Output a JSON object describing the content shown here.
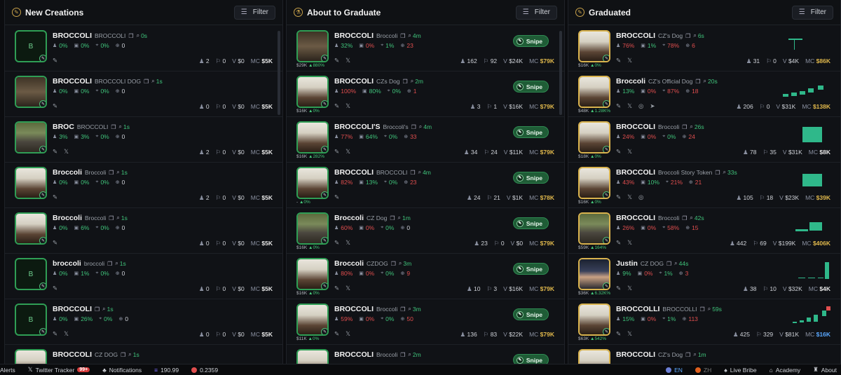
{
  "columns": [
    {
      "title": "New Creations",
      "filter": "Filter",
      "cards": [
        {
          "name": "BROCCOLI",
          "sub": "BROCCOLI",
          "age": "0s",
          "thumb": "empty",
          "letter": "B",
          "h": "0%",
          "b": "0%",
          "s": "0%",
          "t": "0",
          "holders": "2",
          "dl": "0",
          "v": "$0",
          "mc": "$5K",
          "socials": [
            "link"
          ]
        },
        {
          "name": "BROCCOLI",
          "sub": "BROCCOLI DOG",
          "age": "1s",
          "thumb": "d",
          "h": "0%",
          "b": "0%",
          "s": "0%",
          "t": "0",
          "holders": "0",
          "dl": "0",
          "v": "$0",
          "mc": "$5K",
          "socials": [
            "link"
          ]
        },
        {
          "name": "BROC",
          "sub": "BROCCOLI",
          "age": "1s",
          "thumb": "b",
          "h": "3%",
          "b": "3%",
          "s": "0%",
          "t": "0",
          "holders": "2",
          "dl": "0",
          "v": "$0",
          "mc": "$5K",
          "socials": [
            "link",
            "x"
          ]
        },
        {
          "name": "Broccoli",
          "sub": "Broccoli",
          "age": "1s",
          "thumb": "c",
          "h": "0%",
          "b": "0%",
          "s": "0%",
          "t": "0",
          "holders": "2",
          "dl": "0",
          "v": "$0",
          "mc": "$5K",
          "socials": [
            "link"
          ]
        },
        {
          "name": "Broccoli",
          "sub": "Broccoli",
          "age": "1s",
          "thumb": "c",
          "h": "0%",
          "b": "6%",
          "s": "0%",
          "t": "0",
          "holders": "0",
          "dl": "0",
          "v": "$0",
          "mc": "$5K",
          "socials": [
            "link"
          ]
        },
        {
          "name": "broccoli",
          "sub": "broccoli",
          "age": "1s",
          "thumb": "empty",
          "letter": "B",
          "h": "0%",
          "b": "1%",
          "s": "0%",
          "t": "0",
          "holders": "0",
          "dl": "0",
          "v": "$0",
          "mc": "$5K",
          "socials": [
            "link"
          ]
        },
        {
          "name": "BROCCOLI",
          "sub": "",
          "age": "1s",
          "thumb": "empty",
          "letter": "B",
          "h": "0%",
          "b": "26%",
          "s": "0%",
          "t": "0",
          "holders": "0",
          "dl": "0",
          "v": "$0",
          "mc": "$5K",
          "socials": [
            "link",
            "x"
          ]
        },
        {
          "name": "BROCCOLI",
          "sub": "CZ DOG",
          "age": "1s",
          "thumb": "c",
          "h": "",
          "b": "",
          "s": "",
          "t": "",
          "holders": "",
          "dl": "",
          "v": "",
          "mc": "",
          "socials": []
        }
      ]
    },
    {
      "title": "About to Graduate",
      "filter": "Filter",
      "cards": [
        {
          "name": "BROCCOLI",
          "sub": "Broccoli",
          "age": "4m",
          "thumb": "d",
          "cap": "$29K",
          "chg": "880%",
          "h": "32%",
          "b": "0%",
          "s": "1%",
          "t": "23",
          "holders": "162",
          "dl": "92",
          "v": "$24K",
          "mc": "$79K",
          "socials": [
            "link",
            "x"
          ]
        },
        {
          "name": "BROCCOLI",
          "sub": "CZs Dog",
          "age": "2m",
          "thumb": "c",
          "cap": "$16K",
          "chg": "0%",
          "h": "100%",
          "b": "80%",
          "s": "0%",
          "t": "1",
          "holders": "3",
          "dl": "1",
          "v": "$16K",
          "mc": "$79K",
          "socials": [
            "link",
            "x"
          ]
        },
        {
          "name": "BROCCOLI'S",
          "sub": "Broccoli's",
          "age": "4m",
          "thumb": "c",
          "cap": "$16K",
          "chg": "282%",
          "h": "77%",
          "b": "64%",
          "s": "0%",
          "t": "33",
          "holders": "34",
          "dl": "24",
          "v": "$11K",
          "mc": "$79K",
          "socials": [
            "link",
            "x"
          ]
        },
        {
          "name": "BROCCOLI",
          "sub": "BROCCOLI",
          "age": "4m",
          "thumb": "c",
          "cap": "-",
          "chg": "0%",
          "h": "82%",
          "b": "13%",
          "s": "0%",
          "t": "23",
          "holders": "24",
          "dl": "21",
          "v": "$1K",
          "mc": "$78K",
          "socials": [
            "link"
          ]
        },
        {
          "name": "Broccoli",
          "sub": "CZ Dog",
          "age": "1m",
          "thumb": "b",
          "cap": "$16K",
          "chg": "0%",
          "h": "60%",
          "b": "0%",
          "s": "0%",
          "t": "0",
          "holders": "23",
          "dl": "0",
          "v": "$0",
          "mc": "$79K",
          "socials": [
            "link",
            "x"
          ]
        },
        {
          "name": "Broccoli",
          "sub": "CZDOG",
          "age": "3m",
          "thumb": "c",
          "cap": "$16K",
          "chg": "0%",
          "h": "80%",
          "b": "0%",
          "s": "0%",
          "t": "9",
          "holders": "10",
          "dl": "3",
          "v": "$16K",
          "mc": "$79K",
          "socials": [
            "link",
            "x"
          ]
        },
        {
          "name": "BROCCOLI",
          "sub": "Broccoli",
          "age": "3m",
          "thumb": "c",
          "cap": "$11K",
          "chg": "0%",
          "h": "59%",
          "b": "0%",
          "s": "0%",
          "t": "50",
          "holders": "136",
          "dl": "83",
          "v": "$22K",
          "mc": "$79K",
          "socials": [
            "link",
            "x"
          ]
        },
        {
          "name": "BROCCOLI",
          "sub": "Broccoli",
          "age": "2m",
          "thumb": "c",
          "cap": "",
          "chg": "",
          "h": "",
          "b": "",
          "s": "",
          "t": "",
          "holders": "",
          "dl": "",
          "v": "",
          "mc": "",
          "socials": []
        }
      ]
    },
    {
      "title": "Graduated",
      "filter": "Filter",
      "cards": [
        {
          "name": "BROCCOLI",
          "sub": "CZ's Dog",
          "age": "6s",
          "thumb": "c",
          "cap": "$16K",
          "chg": "0%",
          "h": "76%",
          "b": "1%",
          "s": "78%",
          "t": "6",
          "holders": "31",
          "dl": "0",
          "v": "$4K",
          "mc": "$86K",
          "mcc": "mc",
          "socials": [
            "link",
            "x"
          ]
        },
        {
          "name": "Broccoli",
          "sub": "CZ's Official Dog",
          "age": "20s",
          "thumb": "c",
          "cap": "$48K",
          "chg": "1.28K%",
          "h": "13%",
          "b": "0%",
          "s": "87%",
          "t": "18",
          "holders": "206",
          "dl": "0",
          "v": "$31K",
          "mc": "$138K",
          "mcc": "mc",
          "socials": [
            "link",
            "x",
            "web",
            "tg"
          ]
        },
        {
          "name": "BROCCOLI",
          "sub": "Broccoli",
          "age": "26s",
          "thumb": "c",
          "cap": "$18K",
          "chg": "0%",
          "h": "24%",
          "b": "0%",
          "s": "0%",
          "t": "24",
          "holders": "78",
          "dl": "35",
          "v": "$31K",
          "mc": "$8K",
          "mcc": "mcw",
          "socials": [
            "link",
            "x"
          ]
        },
        {
          "name": "BROCCOLI",
          "sub": "Broccoli Story Token",
          "age": "33s",
          "thumb": "c",
          "cap": "$16K",
          "chg": "0%",
          "h": "43%",
          "b": "10%",
          "s": "21%",
          "t": "21",
          "holders": "105",
          "dl": "18",
          "v": "$23K",
          "mc": "$39K",
          "mcc": "mc",
          "socials": [
            "link",
            "x",
            "web"
          ]
        },
        {
          "name": "BROCCOLI",
          "sub": "Broccoli",
          "age": "42s",
          "thumb": "b",
          "cap": "$59K",
          "chg": "164%",
          "h": "26%",
          "b": "0%",
          "s": "58%",
          "t": "15",
          "holders": "442",
          "dl": "69",
          "v": "$199K",
          "mc": "$406K",
          "mcc": "mc",
          "socials": [
            "link",
            "x"
          ]
        },
        {
          "name": "Justin",
          "sub": "CZ DOG",
          "age": "44s",
          "thumb": "e",
          "cap": "$36K",
          "chg": "6.32K%",
          "h": "9%",
          "b": "0%",
          "s": "1%",
          "t": "3",
          "holders": "38",
          "dl": "10",
          "v": "$32K",
          "mc": "$4K",
          "mcc": "mcw",
          "socials": [
            "link",
            "x"
          ]
        },
        {
          "name": "BROCCOLLI",
          "sub": "BROCCOLLI",
          "age": "59s",
          "thumb": "c",
          "cap": "$63K",
          "chg": "542%",
          "h": "15%",
          "b": "0%",
          "s": "1%",
          "t": "113",
          "holders": "425",
          "dl": "329",
          "v": "$81K",
          "mc": "$16K",
          "mcc": "mcb",
          "socials": [
            "link",
            "x"
          ]
        },
        {
          "name": "BROCCOLI",
          "sub": "CZ's Dog",
          "age": "1m",
          "thumb": "c",
          "cap": "",
          "chg": "",
          "h": "",
          "b": "",
          "s": "",
          "t": "",
          "holders": "",
          "dl": "",
          "v": "",
          "mc": "",
          "mcc": "mc",
          "socials": []
        }
      ]
    }
  ],
  "snipe_label": "Snipe",
  "stat_labels": {
    "v": "V",
    "mc": "MC"
  },
  "footer": {
    "alerts": "Alerts",
    "twitter": "Twitter Tracker",
    "badge": "99+",
    "notifications": "Notifications",
    "sol_price": "190.99",
    "bnb_price": "0.2359",
    "en": "EN",
    "zh": "ZH",
    "live_bribe": "Live Bribe",
    "academy": "Academy",
    "about": "About"
  }
}
